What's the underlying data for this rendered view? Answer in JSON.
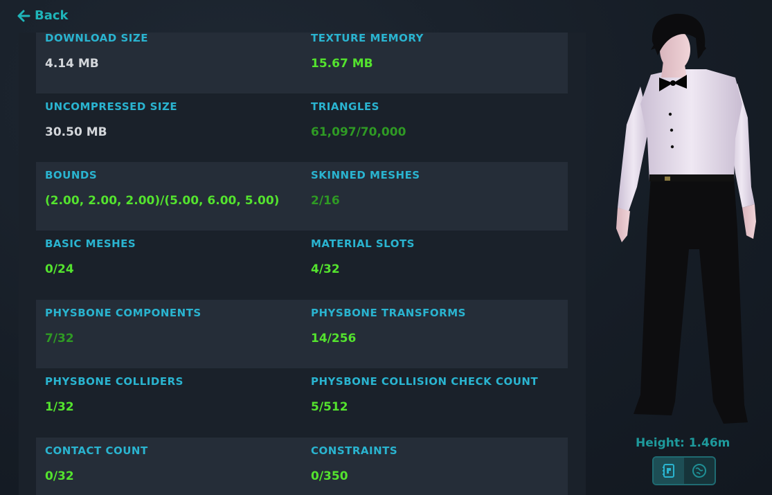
{
  "nav": {
    "back_label": "Back"
  },
  "stats": [
    {
      "left": {
        "label": "DOWNLOAD SIZE",
        "value": "4.14 MB",
        "tone": "white"
      },
      "right": {
        "label": "TEXTURE MEMORY",
        "value": "15.67 MB",
        "tone": "bright"
      }
    },
    {
      "left": {
        "label": "UNCOMPRESSED SIZE",
        "value": "30.50 MB",
        "tone": "white"
      },
      "right": {
        "label": "TRIANGLES",
        "value": "61,097/70,000",
        "tone": "dark"
      }
    },
    {
      "left": {
        "label": "BOUNDS",
        "value": "(2.00, 2.00, 2.00)/(5.00, 6.00, 5.00)",
        "tone": "bright"
      },
      "right": {
        "label": "SKINNED MESHES",
        "value": "2/16",
        "tone": "dark"
      }
    },
    {
      "left": {
        "label": "BASIC MESHES",
        "value": "0/24",
        "tone": "bright"
      },
      "right": {
        "label": "MATERIAL SLOTS",
        "value": "4/32",
        "tone": "bright"
      }
    },
    {
      "left": {
        "label": "PHYSBONE COMPONENTS",
        "value": "7/32",
        "tone": "dark"
      },
      "right": {
        "label": "PHYSBONE TRANSFORMS",
        "value": "14/256",
        "tone": "bright"
      }
    },
    {
      "left": {
        "label": "PHYSBONE COLLIDERS",
        "value": "1/32",
        "tone": "bright"
      },
      "right": {
        "label": "PHYSBONE COLLISION CHECK COUNT",
        "value": "5/512",
        "tone": "bright"
      }
    },
    {
      "left": {
        "label": "CONTACT COUNT",
        "value": "0/32",
        "tone": "bright"
      },
      "right": {
        "label": "CONSTRAINTS",
        "value": "0/350",
        "tone": "bright"
      }
    }
  ],
  "avatar": {
    "height_label": "Height: 1.46m"
  },
  "colors": {
    "accent": "#2ab4d0",
    "good": "#54e32e",
    "ok": "#2f9a24",
    "neutral": "#d4d7db"
  },
  "icons": {
    "back": "arrow-left-icon",
    "view_mode_1": "avatar-card-icon",
    "view_mode_2": "globe-icon"
  }
}
